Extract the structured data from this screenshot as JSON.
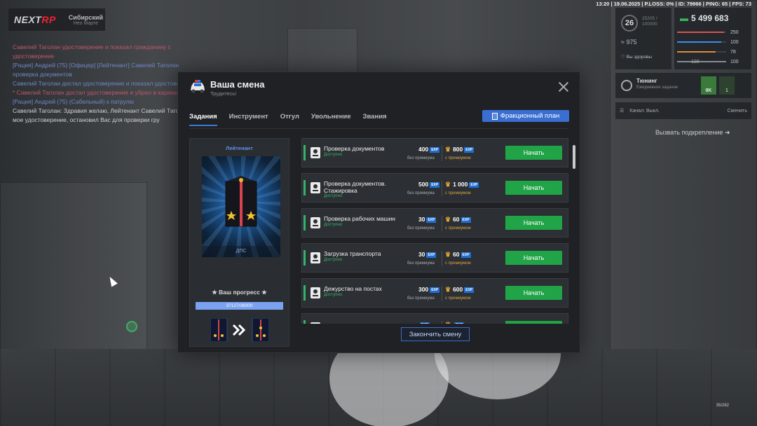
{
  "hud": {
    "logo": "NEXTRP",
    "logo_accent": "RP",
    "logo_main": "NEXT",
    "server_name": "Сибирский",
    "server_sub": "Нео Марте",
    "status_line": "13:20 | 19.06.2025 | P.LOSS: 0% | ID: 79966 | PING: 65 | FPS: 73",
    "level": "26",
    "level_exp": "25205 / 100000",
    "stat_a": "975",
    "health_label": "Вы здоровы",
    "money": "5 499 683",
    "bars": [
      {
        "value": "250",
        "color": "#d9534f",
        "fill": 0.95
      },
      {
        "value": "100",
        "color": "#3a8ee6",
        "fill": 0.9
      },
      {
        "value": "78",
        "color": "#e08a3a",
        "fill": 0.78
      },
      {
        "value": "100",
        "color": "#8a8e93",
        "fill": 1.0
      }
    ],
    "ammo": "128",
    "tuning_title": "Тюнинг",
    "tuning_sub": "Ежедневное задание",
    "tuning_g1": "9K",
    "tuning_g2": "1",
    "channel": "Канал: Выкл.",
    "channel_change": "Сменить",
    "backup": "Вызвать подкрепление",
    "ammo_bottom": "35/262"
  },
  "chat": [
    {
      "text": "Савелий Таголан удостоверение и показал гражданину с",
      "color": "red"
    },
    {
      "text": "удостоверение",
      "color": "red"
    },
    {
      "text": "[Рация] Андрей (75) [Офицер] [Лейтенант] Савелий Таголан",
      "color": "blue"
    },
    {
      "text": "проверка документов",
      "color": "blue"
    },
    {
      "text": "Савелий Таголан достал удостоверение и показал удостоверение",
      "color": "blue"
    },
    {
      "text": "* Савелий Таголан достал удостоверение и убрал в карман",
      "color": "red"
    },
    {
      "text": "[Рация] Андрей (75) (Сабельный) к патрулю",
      "color": "blue"
    },
    {
      "text": "Савелий Таголан: Здравия желаю, Лейтенант Савелий Таголан",
      "color": "grey"
    },
    {
      "text": "мое удостоверение, остановил Вас для проверки гру",
      "color": "grey"
    }
  ],
  "modal": {
    "title": "Ваша смена",
    "subtitle": "Трудитесь!",
    "tabs": [
      "Задания",
      "Инструмент",
      "Отгул",
      "Увольнение",
      "Звания"
    ],
    "faction_plan": "Фракционный план",
    "rank": {
      "name": "Лейтенант",
      "unit": "ДПС",
      "progress_title": "★ Ваш прогресс ★",
      "progress_text": "37127/36000",
      "progress_fill": 1.0
    },
    "tasks": [
      {
        "name": "Проверка документов",
        "status": "Доступно",
        "exp": "400",
        "exp_premium": "800",
        "icon": "document-icon"
      },
      {
        "name": "Проверка документов. Стажировка",
        "status": "Доступно",
        "exp": "500",
        "exp_premium": "1 000",
        "icon": "officers-icon"
      },
      {
        "name": "Проверка рабочих машин",
        "status": "Доступно",
        "exp": "30",
        "exp_premium": "60",
        "icon": "police-car-icon"
      },
      {
        "name": "Загрузка транспорта",
        "status": "Доступно",
        "exp": "30",
        "exp_premium": "60",
        "icon": "loading-icon"
      },
      {
        "name": "Дежурство на постах",
        "status": "Доступно",
        "exp": "300",
        "exp_premium": "600",
        "icon": "guard-post-icon"
      },
      {
        "name": "",
        "status": "",
        "exp": "",
        "exp_premium": "",
        "icon": "task-icon"
      }
    ],
    "exp_tag": "EXP",
    "label_no_premium": "без премиума",
    "label_premium": "с премиумом",
    "start_label": "Начать",
    "finish_shift": "Закончить смену"
  },
  "colors": {
    "accent_blue": "#3a6ed0",
    "start_green": "#21a447",
    "status_green": "#36b46a",
    "premium_gold": "#dca448"
  }
}
